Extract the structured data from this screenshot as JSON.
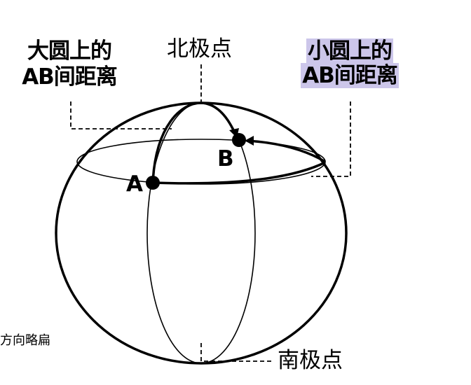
{
  "labels": {
    "great_circle_line1": "大圆上的",
    "great_circle_line2": "AB间距离",
    "north_pole": "北极点",
    "small_circle_line1": "小圆上的",
    "small_circle_line2": "AB间距离",
    "point_a": "A",
    "point_b": "B",
    "south_pole": "南极点",
    "footnote": "北方向略扁"
  },
  "colors": {
    "highlight": "#ccc6ea",
    "stroke": "#000000"
  }
}
